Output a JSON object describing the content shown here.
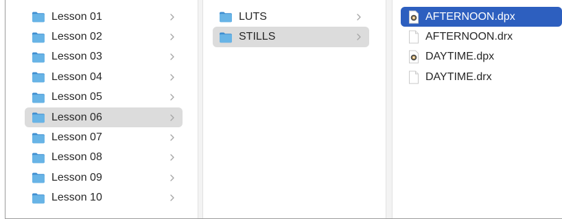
{
  "column1": {
    "items": [
      {
        "label": "Lesson 01"
      },
      {
        "label": "Lesson 02"
      },
      {
        "label": "Lesson 03"
      },
      {
        "label": "Lesson 04"
      },
      {
        "label": "Lesson 05"
      },
      {
        "label": "Lesson 06"
      },
      {
        "label": "Lesson 07"
      },
      {
        "label": "Lesson 08"
      },
      {
        "label": "Lesson 09"
      },
      {
        "label": "Lesson 10"
      }
    ],
    "selected": "Lesson 06"
  },
  "column2": {
    "items": [
      {
        "label": "LUTS"
      },
      {
        "label": "STILLS"
      }
    ],
    "selected": "STILLS"
  },
  "column3": {
    "items": [
      {
        "label": "AFTERNOON.dpx",
        "icon": "dpx-file-icon"
      },
      {
        "label": "AFTERNOON.drx",
        "icon": "document-icon"
      },
      {
        "label": "DAYTIME.dpx",
        "icon": "dpx-file-icon"
      },
      {
        "label": "DAYTIME.drx",
        "icon": "document-icon"
      }
    ],
    "selected": "AFTERNOON.dpx"
  },
  "colors": {
    "selection_blue": "#2d5fbf",
    "selection_gray": "#dcdcdc",
    "folder_blue": "#5aa9df"
  }
}
